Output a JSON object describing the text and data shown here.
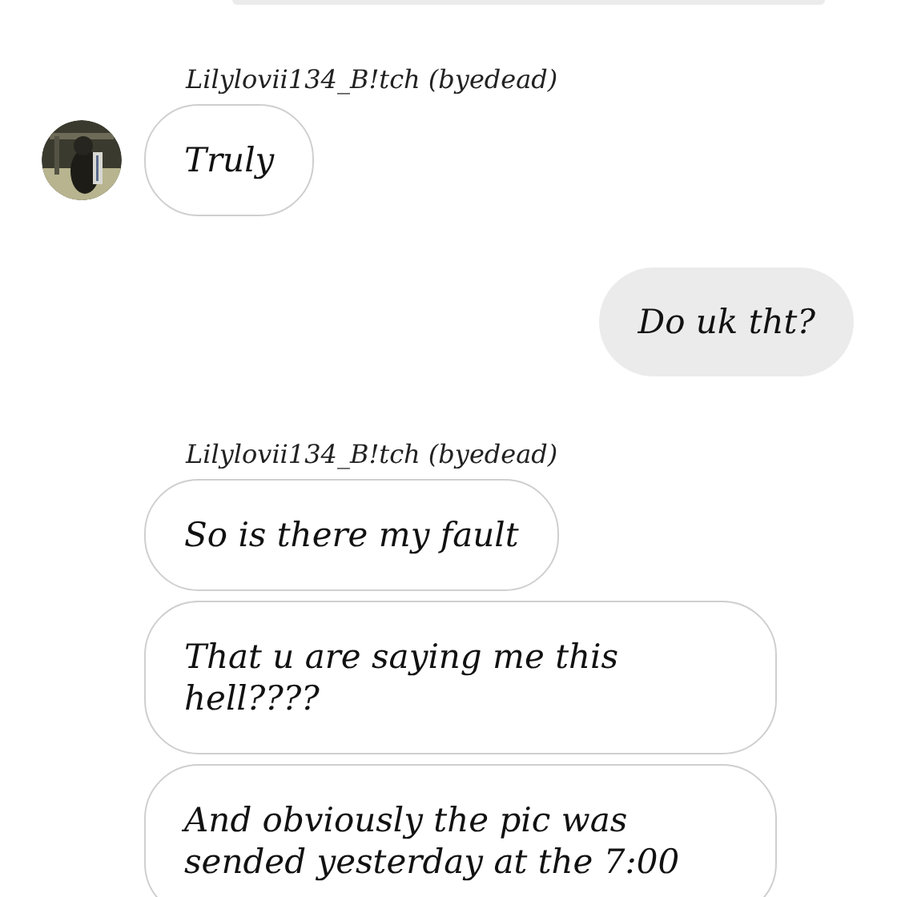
{
  "messages": [
    {
      "kind": "sent_partial"
    },
    {
      "kind": "received",
      "sender": "Lilylovii134_B!tch (byedead)",
      "avatar": true,
      "bubbles": [
        "Truly"
      ]
    },
    {
      "kind": "sent",
      "text": "Do uk tht?"
    },
    {
      "kind": "received",
      "sender": "Lilylovii134_B!tch (byedead)",
      "avatar": false,
      "bubbles": [
        "So is there my fault",
        "That u are saying me this hell????",
        "And obviously the pic was sended yesterday at the 7:00"
      ]
    }
  ]
}
